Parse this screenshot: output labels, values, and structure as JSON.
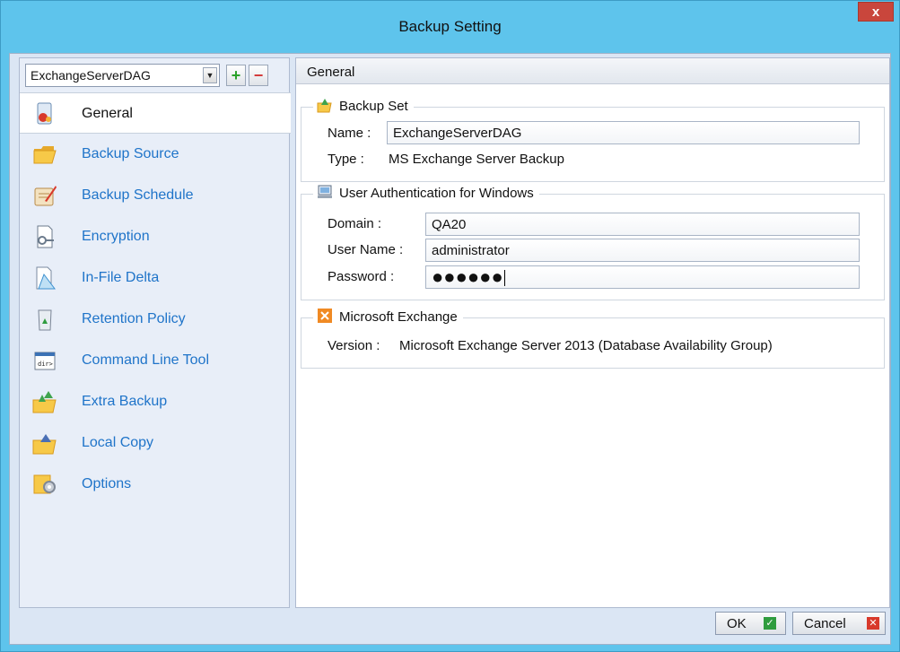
{
  "window": {
    "title": "Backup Setting",
    "close_label": "x"
  },
  "sidebar": {
    "backup_set_selected": "ExchangeServerDAG",
    "add_label": "+",
    "remove_label": "−",
    "items": [
      {
        "label": "General",
        "icon": "general-icon",
        "active": true
      },
      {
        "label": "Backup Source",
        "icon": "folder-icon"
      },
      {
        "label": "Backup Schedule",
        "icon": "schedule-icon"
      },
      {
        "label": "Encryption",
        "icon": "key-icon"
      },
      {
        "label": "In-File Delta",
        "icon": "delta-icon"
      },
      {
        "label": "Retention Policy",
        "icon": "recycle-icon"
      },
      {
        "label": "Command Line Tool",
        "icon": "terminal-icon"
      },
      {
        "label": "Extra Backup",
        "icon": "extra-backup-icon"
      },
      {
        "label": "Local Copy",
        "icon": "local-copy-icon"
      },
      {
        "label": "Options",
        "icon": "options-gear-icon"
      }
    ]
  },
  "panel": {
    "header": "General",
    "backup_set": {
      "title": "Backup Set",
      "name_label": "Name :",
      "name_value": "ExchangeServerDAG",
      "type_label": "Type :",
      "type_value": "MS Exchange Server Backup"
    },
    "auth": {
      "title": "User Authentication for Windows",
      "domain_label": "Domain :",
      "domain_value": "QA20",
      "username_label": "User Name :",
      "username_value": "administrator",
      "password_label": "Password :",
      "password_value": "●●●●●●"
    },
    "exchange": {
      "title": "Microsoft Exchange",
      "version_label": "Version :",
      "version_value": "Microsoft Exchange Server 2013 (Database Availability Group)"
    }
  },
  "footer": {
    "ok_label": "OK",
    "cancel_label": "Cancel"
  },
  "colors": {
    "titlebar": "#5ec4ec",
    "nav_text": "#1f74c9",
    "close": "#c9463c"
  }
}
